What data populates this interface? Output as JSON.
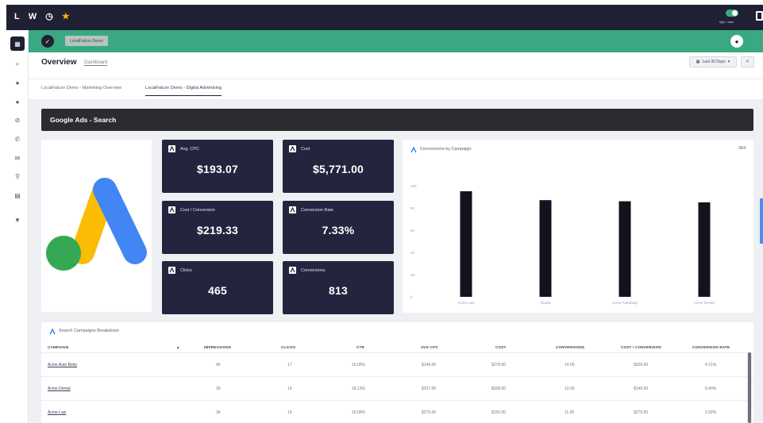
{
  "topbar": {
    "brand_letters": [
      "L",
      "W"
    ],
    "toggle_label": "light / dark"
  },
  "app_header": {
    "chip_label": "LocalFalcon Demo"
  },
  "overview": {
    "title": "Overview",
    "subtitle": "Dashboard",
    "date_range": "Last 30 Days",
    "date_caret": "▾",
    "share_glyph": "<"
  },
  "tabs": [
    {
      "label": "LocalFalcon Demo - Marketing Overview"
    },
    {
      "label": "LocalFalcon Demo - Digital Advertising"
    }
  ],
  "section": {
    "title": "Google Ads - Search"
  },
  "kpis": [
    {
      "label": "Avg. CPC",
      "value": "$193.07"
    },
    {
      "label": "Cost",
      "value": "$5,771.00"
    },
    {
      "label": "Cost / Conversion",
      "value": "$219.33"
    },
    {
      "label": "Conversion Rate",
      "value": "7.33%"
    },
    {
      "label": "Clicks",
      "value": "465"
    },
    {
      "label": "Conversions",
      "value": "813"
    }
  ],
  "chart_data": {
    "type": "bar",
    "title": "Conversions by Campaign",
    "total": "364",
    "categories": [
      "Acme Law",
      "Global",
      "Acme AutoBody",
      "Acme Dental"
    ],
    "values": [
      95,
      87,
      86,
      85
    ],
    "ylim": [
      0,
      120
    ],
    "yticks": [
      "0",
      "20",
      "40",
      "60",
      "80",
      "100"
    ],
    "bar_color": "#12131f",
    "grid": false
  },
  "table": {
    "title": "Search Campaigns Breakdown",
    "sort_glyph": "▲",
    "columns": [
      "CAMPAIGN",
      "IMPRESSIONS",
      "CLICKS",
      "CTR",
      "AVG CPC",
      "COST",
      "CONVERSIONS",
      "COST / CONVERSION",
      "CONVERSION RATE"
    ],
    "rows": [
      [
        "Acme Auto Body",
        "45",
        "17",
        "16.00%",
        "$146.00",
        "$278.00",
        "14.00",
        "$206.00",
        "4.21%"
      ],
      [
        "Acme Dental",
        "18",
        "19",
        "18.13%",
        "$237.00",
        "$208.00",
        "13.00",
        "$146.00",
        "5.40%"
      ],
      [
        "Acme Law",
        "34",
        "19",
        "16.00%",
        "$275.00",
        "$150.00",
        "11.00",
        "$275.00",
        "2.92%"
      ]
    ]
  },
  "colors": {
    "topbar": "#1f2033",
    "accent_green": "#3aa982",
    "kpi_card": "#23253f",
    "section_header": "#2b2c2f",
    "canvas": "#eef0f3",
    "google_blue": "#4285f4",
    "google_yellow": "#fbbc04",
    "google_green": "#34a853"
  },
  "icons": {
    "sidebar": [
      "grid-icon",
      "search-icon",
      "location-pin-icon",
      "chat-icon",
      "link-icon",
      "phone-icon",
      "mail-icon",
      "map-pin-icon",
      "cart-icon",
      "filter-icon"
    ]
  }
}
